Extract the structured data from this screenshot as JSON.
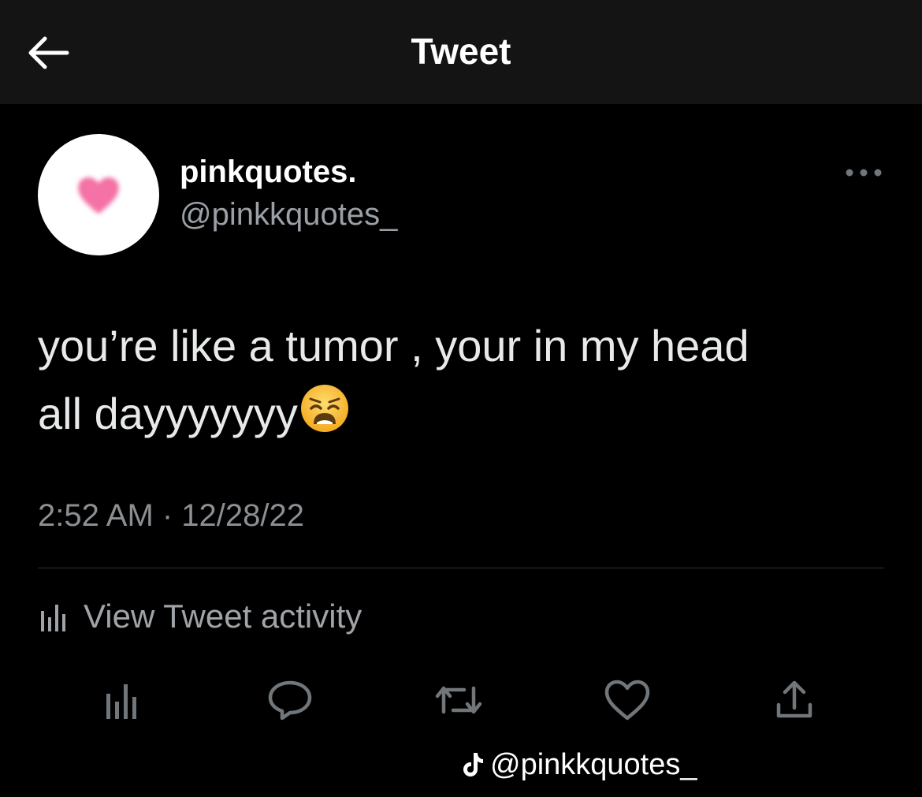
{
  "header": {
    "title": "Tweet",
    "back_icon": "arrow-left-icon"
  },
  "tweet": {
    "author": {
      "display_name": "pinkquotes.",
      "handle": "@pinkkquotes_",
      "avatar_icon": "pink-heart-icon"
    },
    "more_icon": "more-horizontal-icon",
    "text_line1": "you’re like a tumor , your in my head",
    "text_line2": "all dayyyyyyy",
    "emoji": "weary-face-emoji",
    "timestamp": "2:52 AM · 12/28/22",
    "activity_label": "View Tweet activity",
    "actions": [
      "analytics-icon",
      "reply-icon",
      "retweet-icon",
      "like-icon",
      "share-icon"
    ]
  },
  "watermark": {
    "icon": "tiktok-icon",
    "text": "@pinkkquotes_"
  },
  "colors": {
    "background": "#000000",
    "header_bg": "#141414",
    "primary_text": "#e7e9ea",
    "secondary_text": "#8b8f93",
    "divider": "#2f3336",
    "heart": "#f472a6"
  }
}
